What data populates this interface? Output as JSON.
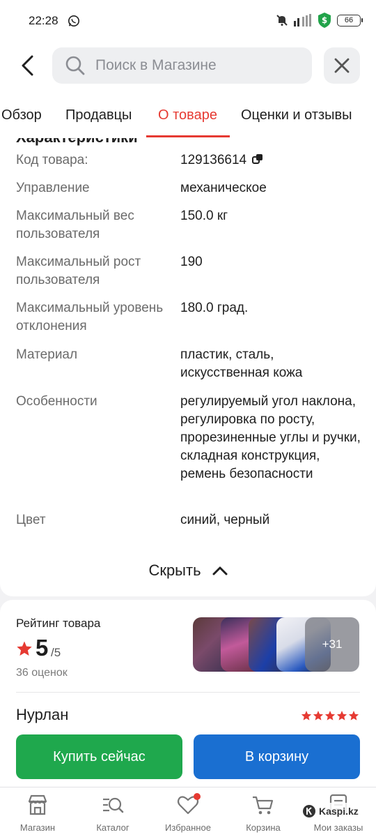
{
  "status": {
    "time": "22:28",
    "battery": "66"
  },
  "search": {
    "placeholder": "Поиск в Магазине"
  },
  "tabs": [
    {
      "label": "Обзор"
    },
    {
      "label": "Продавцы"
    },
    {
      "label": "О товаре"
    },
    {
      "label": "Оценки и отзывы"
    }
  ],
  "specs": {
    "heading": "Характеристики",
    "rows": [
      {
        "label": "Код товара:",
        "value": "129136614"
      },
      {
        "label": "Управление",
        "value": "механическое"
      },
      {
        "label": "Максимальный вес пользователя",
        "value": "150.0 кг"
      },
      {
        "label": "Максимальный рост пользователя",
        "value": "190"
      },
      {
        "label": "Максимальный уровень отклонения",
        "value": "180.0 град."
      },
      {
        "label": "Материал",
        "value": "пластик, сталь, искусственная кожа"
      },
      {
        "label": "Особенности",
        "value": "регулируемый угол наклона, регулировка по росту, прорезиненные углы и ручки, складная конструкция, ремень безопасности"
      },
      {
        "label": "Цвет",
        "value": "синий, черный"
      }
    ],
    "hide_label": "Скрыть"
  },
  "rating": {
    "title": "Рейтинг товара",
    "score": "5",
    "max": "/5",
    "count": "36 оценок",
    "more_photos": "+31"
  },
  "review": {
    "author": "Нурлан",
    "stars": 5
  },
  "actions": {
    "buy_now": "Купить сейчас",
    "to_cart": "В корзину"
  },
  "nav": [
    {
      "label": "Магазин"
    },
    {
      "label": "Каталог"
    },
    {
      "label": "Избранное"
    },
    {
      "label": "Корзина"
    },
    {
      "label": "Мои заказы"
    }
  ],
  "watermark": "Kaspi.kz",
  "colors": {
    "accent": "#e63a32",
    "buy": "#1fa84d",
    "cart": "#1a6fd1"
  }
}
